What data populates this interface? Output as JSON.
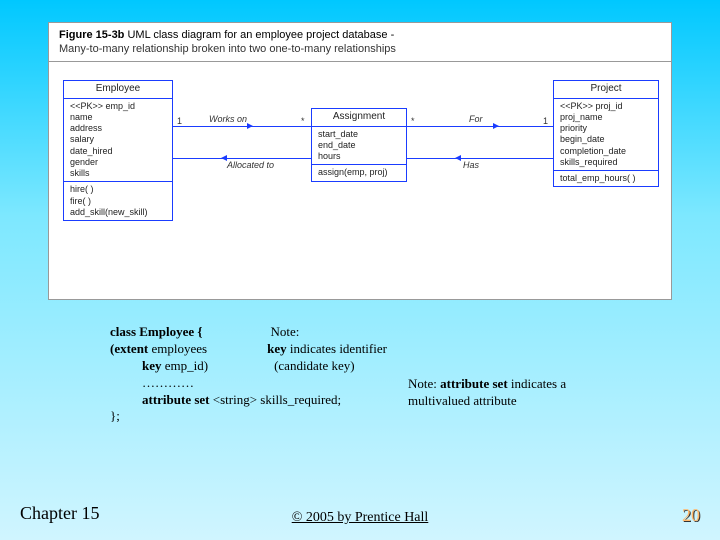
{
  "figure": {
    "label": "Figure 15-3b",
    "title_rest": " UML class diagram for an employee project database -",
    "subtitle": "Many-to-many relationship broken into two one-to-many relationships"
  },
  "employee": {
    "name": "Employee",
    "pk": "<<PK>> emp_id",
    "attrs": [
      "name",
      "address",
      "salary",
      "date_hired",
      "gender",
      "skills"
    ],
    "ops": [
      "hire( )",
      "fire( )",
      "add_skill(new_skill)"
    ]
  },
  "assignment": {
    "name": "Assignment",
    "attrs": [
      "start_date",
      "end_date",
      "hours"
    ],
    "ops": [
      "assign(emp, proj)"
    ]
  },
  "project": {
    "name": "Project",
    "pk": "<<PK>> proj_id",
    "attrs": [
      "proj_name",
      "priority",
      "begin_date",
      "completion_date",
      "skills_required"
    ],
    "ops": [
      "total_emp_hours( )"
    ]
  },
  "assoc": {
    "left_top": "Works on",
    "left_bottom": "Allocated to",
    "right_top": "For",
    "right_bottom": "Has",
    "mult_one_left": "1",
    "mult_star_left": "*",
    "mult_star_right": "*",
    "mult_one_right": "1"
  },
  "notes": {
    "l1a": "class Employee {",
    "l1b": "Note:",
    "l2a": "(extent ",
    "l2a2": "employees",
    "l2b": "key",
    "l2b2": " indicates identifier",
    "l3a": "key ",
    "l3a2": "emp_id)",
    "l3b": "(candidate key)",
    "l4": "…………",
    "l5a": "attribute set ",
    "l5b": "<string> skills_required;",
    "l6": "};",
    "r1": "Note: ",
    "r1b": "attribute set",
    "r1c": " indicates a",
    "r2": "multivalued attribute"
  },
  "footer": {
    "chapter": "Chapter 15",
    "copyright": "© 2005 by Prentice Hall",
    "page": "20"
  }
}
